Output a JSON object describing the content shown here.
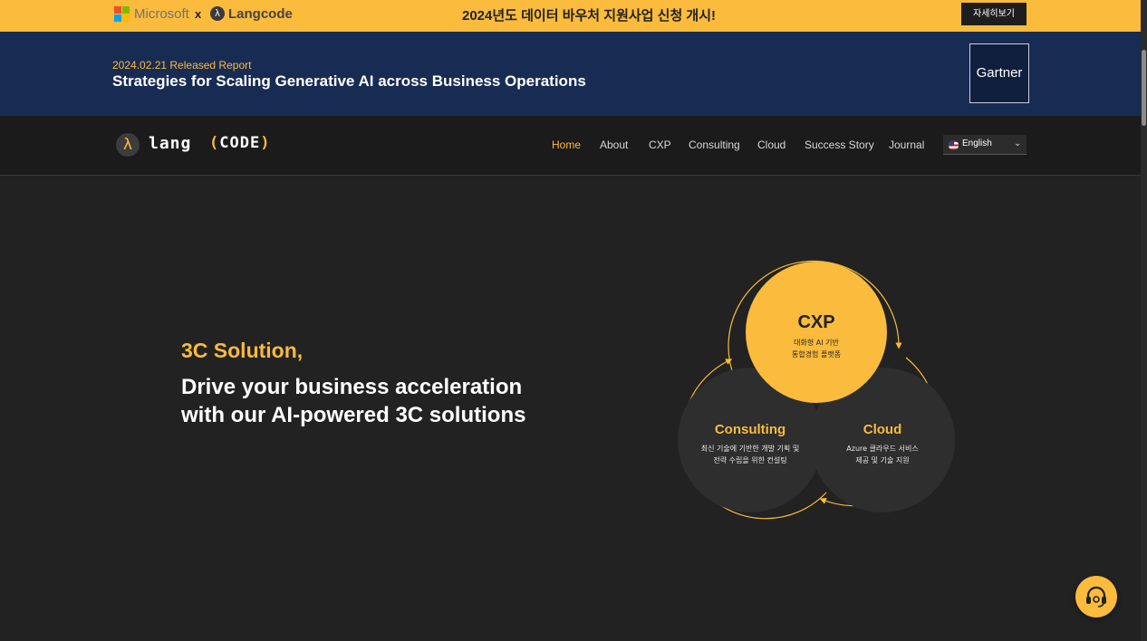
{
  "promo": {
    "ms_name": "Microsoft",
    "times": "x",
    "langcode_name": "Langcode",
    "message": "2024년도 데이터 바우처 지원사업 신청 개시!",
    "button": "자세히보기"
  },
  "banner": {
    "date": "2024.02.21 Released Report",
    "title": "Strategies for Scaling Generative AI across Business Operations",
    "badge": "Gartner"
  },
  "nav": {
    "logo_symbol": "λ",
    "logo_lang": "lang",
    "logo_code_open": "(",
    "logo_code": "CODE",
    "logo_code_close": ")",
    "links": [
      "Home",
      "About",
      "CXP",
      "Consulting",
      "Cloud",
      "Success Story",
      "Journal"
    ],
    "active": "Home",
    "language": "English"
  },
  "hero": {
    "subtitle": "3C Solution,",
    "title_line1": "Drive your business acceleration",
    "title_line2": "with our AI-powered 3C solutions"
  },
  "diagram": {
    "cxp": {
      "title": "CXP",
      "line1": "대화형 AI 기반",
      "line2": "통합경험 플랫폼"
    },
    "consulting": {
      "title": "Consulting",
      "line1": "최신 기술에 기반한 개발 기획 및",
      "line2": "전략 수립을 위한 컨설팅"
    },
    "cloud": {
      "title": "Cloud",
      "line1": "Azure 클라우드 서비스",
      "line2": "제공 및 기술 지원"
    }
  },
  "colors": {
    "accent": "#fbbb3c",
    "banner_bg": "#182b53",
    "page_bg": "#222222",
    "nav_bg": "#1b1b1b"
  },
  "icons": {
    "support": "headset-icon",
    "language_flag": "us-flag-icon",
    "dropdown": "chevron-down-icon"
  }
}
